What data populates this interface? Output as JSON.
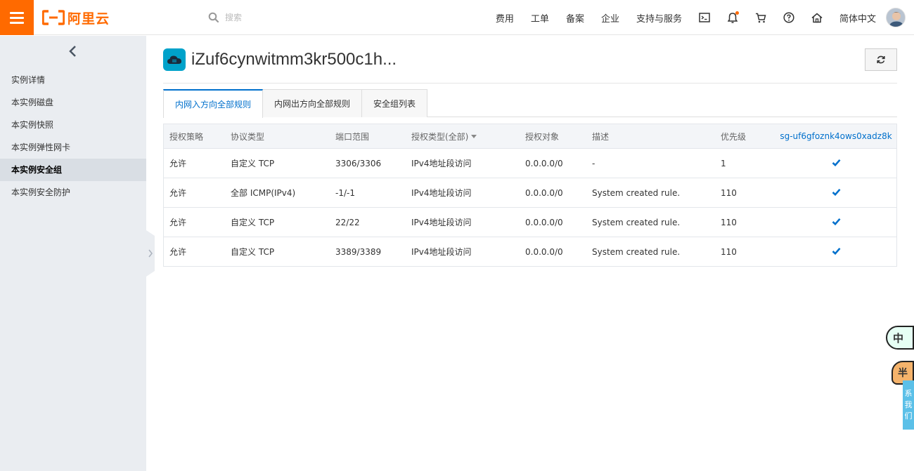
{
  "header": {
    "logo_text": "阿里云",
    "search_placeholder": "搜索",
    "nav": [
      "费用",
      "工单",
      "备案",
      "企业",
      "支持与服务"
    ],
    "language": "简体中文",
    "accent": "#ff6a00"
  },
  "sidebar": {
    "items": [
      {
        "label": "实例详情",
        "active": false
      },
      {
        "label": "本实例磁盘",
        "active": false
      },
      {
        "label": "本实例快照",
        "active": false
      },
      {
        "label": "本实例弹性网卡",
        "active": false
      },
      {
        "label": "本实例安全组",
        "active": true
      },
      {
        "label": "本实例安全防护",
        "active": false
      }
    ]
  },
  "main": {
    "title": "iZuf6cynwitmm3kr500c1h...",
    "tabs": [
      {
        "label": "内网入方向全部规则",
        "active": true
      },
      {
        "label": "内网出方向全部规则",
        "active": false
      },
      {
        "label": "安全组列表",
        "active": false
      }
    ],
    "table": {
      "headers": [
        "授权策略",
        "协议类型",
        "端口范围",
        "授权类型(全部)",
        "授权对象",
        "描述",
        "优先级",
        "sg-uf6gfoznk4ows0xadz8k"
      ],
      "rows": [
        [
          "允许",
          "自定义 TCP",
          "3306/3306",
          "IPv4地址段访问",
          "0.0.0.0/0",
          "-",
          "1"
        ],
        [
          "允许",
          "全部 ICMP(IPv4)",
          "-1/-1",
          "IPv4地址段访问",
          "0.0.0.0/0",
          "System created rule.",
          "110"
        ],
        [
          "允许",
          "自定义 TCP",
          "22/22",
          "IPv4地址段访问",
          "0.0.0.0/0",
          "System created rule.",
          "110"
        ],
        [
          "允许",
          "自定义 TCP",
          "3389/3389",
          "IPv4地址段访问",
          "0.0.0.0/0",
          "System created rule.",
          "110"
        ]
      ]
    }
  },
  "float_widget": {
    "bubble_text": "中",
    "hat_text": "半",
    "contact_chars": [
      "系",
      "我",
      "们"
    ]
  }
}
